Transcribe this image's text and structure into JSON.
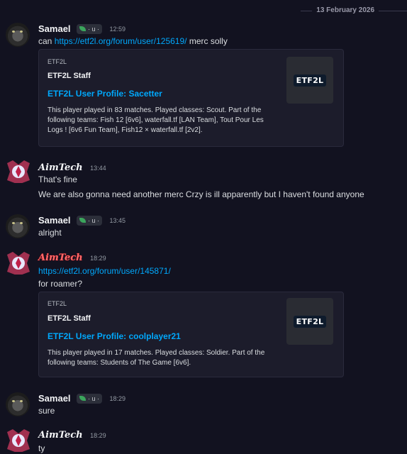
{
  "date_divider": "13 February 2026",
  "messages": [
    {
      "author": "Samael",
      "tag": "· u ·",
      "time": "12:59",
      "lines": [
        "can",
        "https://etf2l.org/forum/user/125619/",
        "merc solly"
      ],
      "embed": {
        "provider": "ETF2L",
        "author": "ETF2L Staff",
        "title": "ETF2L User Profile: Sacetter",
        "desc": "This player played in 83 matches. Played classes: Scout. Part of the following teams: Fish 12 [6v6], waterfall.tf [LAN Team], Tout Pour Les Logs ! [6v6 Fun Team], Fish12 × waterfall.tf [2v2].",
        "thumb_logo": "ETF2L"
      }
    },
    {
      "author": "AimTech",
      "time": "13:44",
      "lines": [
        "That's fine",
        "We are also gonna need another merc Crzy is ill apparently but I haven't found anyone"
      ]
    },
    {
      "author": "Samael",
      "tag": "· u ·",
      "time": "13:45",
      "lines": [
        "alright"
      ]
    },
    {
      "author": "AimTech",
      "time": "18:29",
      "lines": [
        "https://etf2l.org/forum/user/145871/",
        "for roamer?"
      ],
      "embed": {
        "provider": "ETF2L",
        "author": "ETF2L Staff",
        "title": "ETF2L User Profile: coolplayer21",
        "desc": "This player played in 17 matches. Played classes: Soldier. Part of the following teams: Students of The Game [6v6].",
        "thumb_logo": "ETF2L"
      }
    },
    {
      "author": "Samael",
      "tag": "· u ·",
      "time": "18:29",
      "lines": [
        "sure"
      ]
    },
    {
      "author": "AimTech",
      "time": "18:29",
      "lines": [
        "ty"
      ]
    }
  ],
  "colors": {
    "background": "#121220",
    "link": "#00a8fc",
    "embed_bg": "#1c1c2b",
    "leaf_badge": "#3ba55c"
  }
}
